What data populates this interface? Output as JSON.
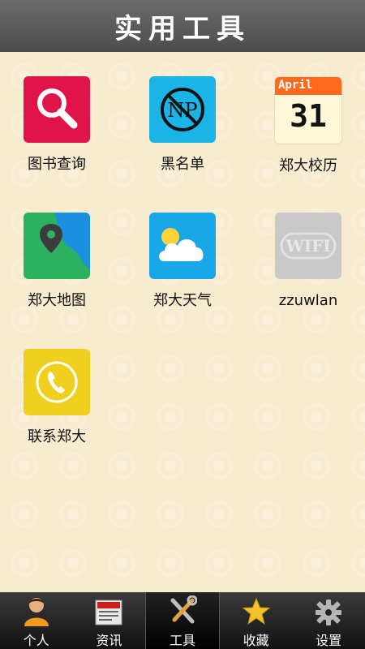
{
  "header": {
    "title": "实用工具"
  },
  "tools": [
    {
      "label": "图书查询",
      "icon": "search-icon"
    },
    {
      "label": "黑名单",
      "icon": "no-parking-icon"
    },
    {
      "label": "郑大校历",
      "icon": "calendar-icon",
      "month": "April",
      "day": "31"
    },
    {
      "label": "郑大地图",
      "icon": "map-pin-icon"
    },
    {
      "label": "郑大天气",
      "icon": "weather-icon"
    },
    {
      "label": "zzuwlan",
      "icon": "wifi-icon",
      "icon_text": "WIFI"
    },
    {
      "label": "联系郑大",
      "icon": "phone-icon"
    }
  ],
  "tabbar": {
    "items": [
      {
        "label": "个人",
        "icon": "person-icon"
      },
      {
        "label": "资讯",
        "icon": "news-icon"
      },
      {
        "label": "工具",
        "icon": "tools-icon",
        "active": true
      },
      {
        "label": "收藏",
        "icon": "star-icon"
      },
      {
        "label": "设置",
        "icon": "gear-icon"
      }
    ]
  },
  "colors": {
    "search_bg": "#e0134a",
    "np_bg": "#1bb4e6",
    "map_green": "#2bb15f",
    "weather_bg": "#1aa7e9",
    "wifi_bg": "#c9c9c9",
    "phone_bg": "#efd01f",
    "active_tab": "#000000"
  }
}
